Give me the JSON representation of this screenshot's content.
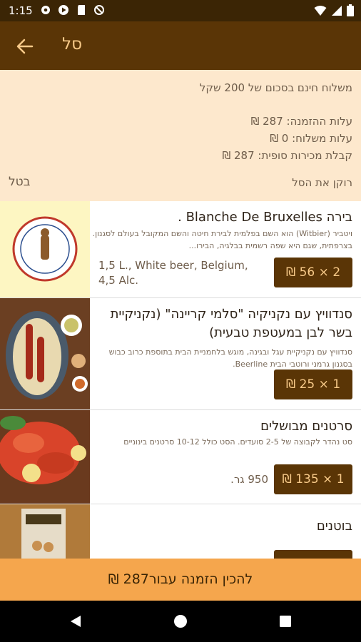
{
  "status_bar": {
    "time": "1:15"
  },
  "app_bar": {
    "title": "סל"
  },
  "summary": {
    "free_shipping": "משלוח חינם בסכום של 200 שקל",
    "order_cost": "עלות ההזמנה: 287 ₪",
    "shipping_cost": "עלות משלוח: 0 ₪",
    "final_total": "קבלת מכירות סופית: 287 ₪",
    "clear_cart": "רוקן את הסל",
    "cancel": "בטל"
  },
  "items": [
    {
      "name": "בירה Blanche De Bruxelles .",
      "description": "ויטביר (Witbier) הוא השם בפלמית לבירת חיטה והשם המקובל בעולם לסגנון. בצרפתית, שגם היא שפה רשמית בבלגיה, הבירו...",
      "meta": "1,5 L., White beer, Belgium, 4,5 Alc.",
      "qty": "2 × 56 ₪"
    },
    {
      "name": "סנדוויץ עם נקניקיה \"סלמי קריינה\" (נקניקיית בשר לבן במעטפת טבעית)",
      "description": "סנדוויץ עם נקניקיית עגל ובגינה, מוגש בלחמניית הבית בתוספת כרוב כבוש בסגנון גרמני ורוטבי הבית Beerline.",
      "meta": "",
      "qty": "1 × 25 ₪"
    },
    {
      "name": "סרטנים מבושלים",
      "description": "סט נהדר לקבוצה של 2-5 סועדים. הסט כולל 10-12 סרטנים בינוניים",
      "meta": "950 גר.",
      "qty": "1 × 135 ₪"
    },
    {
      "name": "בוטנים",
      "description": "",
      "meta": "",
      "qty": ""
    }
  ],
  "checkout": {
    "label": "להכין הזמנה עבור287 ₪"
  },
  "colors": {
    "primary": "#5a3506",
    "accent": "#f5a64d",
    "summary_bg": "#fde8cd"
  }
}
